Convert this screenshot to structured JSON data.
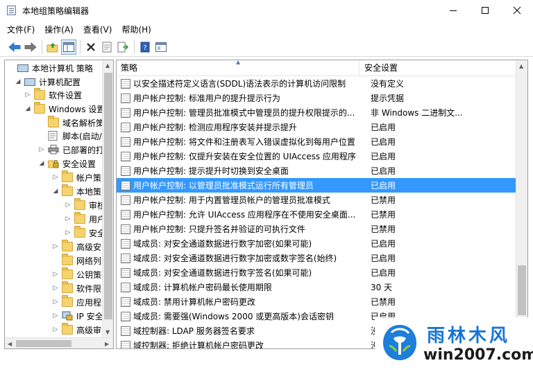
{
  "window": {
    "title": "本地组策略编辑器"
  },
  "menu": [
    "文件(F)",
    "操作(A)",
    "查看(V)",
    "帮助(H)"
  ],
  "tree": [
    {
      "label": "本地计算机 策略",
      "toggle": "",
      "icon": "computer-icon"
    },
    {
      "label": "计算机配置",
      "toggle": "◢",
      "icon": "computer-icon"
    },
    {
      "label": "软件设置",
      "toggle": "▷",
      "icon": "folder-icon"
    },
    {
      "label": "Windows 设置",
      "toggle": "◢",
      "icon": "folder-icon"
    },
    {
      "label": "域名解析策",
      "toggle": "",
      "icon": "folder-icon"
    },
    {
      "label": "脚本(启动/",
      "toggle": "",
      "icon": "script-icon"
    },
    {
      "label": "已部署的打",
      "toggle": "▷",
      "icon": "printer-icon"
    },
    {
      "label": "安全设置",
      "toggle": "◢",
      "icon": "security-folder-icon"
    },
    {
      "label": "帐户策",
      "toggle": "▷",
      "icon": "folder-icon"
    },
    {
      "label": "本地策",
      "toggle": "◢",
      "icon": "folder-icon"
    },
    {
      "label": "审核",
      "toggle": "▷",
      "icon": "folder-icon"
    },
    {
      "label": "用户",
      "toggle": "▷",
      "icon": "folder-icon"
    },
    {
      "label": "安全",
      "toggle": "▷",
      "icon": "folder-icon"
    },
    {
      "label": "高级安",
      "toggle": "▷",
      "icon": "folder-icon"
    },
    {
      "label": "网络列",
      "toggle": "",
      "icon": "folder-icon"
    },
    {
      "label": "公钥策",
      "toggle": "▷",
      "icon": "folder-icon"
    },
    {
      "label": "软件限",
      "toggle": "▷",
      "icon": "folder-icon"
    },
    {
      "label": "应用程",
      "toggle": "▷",
      "icon": "folder-icon"
    },
    {
      "label": "IP 安全",
      "toggle": "▷",
      "icon": "ip-security-icon"
    },
    {
      "label": "高级审",
      "toggle": "▷",
      "icon": "folder-icon"
    }
  ],
  "list": {
    "headers": {
      "policy": "策略",
      "setting": "安全设置"
    },
    "rows": [
      {
        "policy": "以安全描述符定义语言(SDDL)语法表示的计算机访问限制",
        "setting": "没有定义"
      },
      {
        "policy": "用户帐户控制: 标准用户的提升提示行为",
        "setting": "提示凭据"
      },
      {
        "policy": "用户帐户控制: 管理员批准模式中管理员的提升权限提示的...",
        "setting": "非 Windows 二进制文..."
      },
      {
        "policy": "用户帐户控制: 检测应用程序安装并提示提升",
        "setting": "已启用"
      },
      {
        "policy": "用户帐户控制: 将文件和注册表写入错误虚拟化到每用户位置",
        "setting": "已启用"
      },
      {
        "policy": "用户帐户控制: 仅提升安装在安全位置的 UIAccess 应用程序",
        "setting": "已启用"
      },
      {
        "policy": "用户帐户控制: 提示提升时切换到安全桌面",
        "setting": "已启用"
      },
      {
        "policy": "用户帐户控制: 以管理员批准模式运行所有管理员",
        "setting": "已启用",
        "selected": true
      },
      {
        "policy": "用户帐户控制: 用于内置管理员帐户的管理员批准模式",
        "setting": "已禁用"
      },
      {
        "policy": "用户帐户控制: 允许 UIAccess 应用程序在不使用安全桌面...",
        "setting": "已禁用"
      },
      {
        "policy": "用户帐户控制: 只提升签名并验证的可执行文件",
        "setting": "已禁用"
      },
      {
        "policy": "域成员: 对安全通道数据进行数字加密(如果可能)",
        "setting": "已启用"
      },
      {
        "policy": "域成员: 对安全通道数据进行数字加密或数字签名(始终)",
        "setting": "已启用"
      },
      {
        "policy": "域成员: 对安全通道数据进行数字签名(如果可能)",
        "setting": "已启用"
      },
      {
        "policy": "域成员: 计算机帐户密码最长使用期限",
        "setting": "30 天"
      },
      {
        "policy": "域成员: 禁用计算机帐户密码更改",
        "setting": "已禁用"
      },
      {
        "policy": "域成员: 需要强(Windows 2000 或更高版本)会话密钥",
        "setting": "已启用"
      },
      {
        "policy": "域控制器: LDAP 服务器签名要求",
        "setting": "没有"
      },
      {
        "policy": "域控制器: 拒绝计算机帐户密码更改",
        "setting": "没有"
      }
    ]
  },
  "watermark": {
    "brand": "雨林木风",
    "url": "win2007.com"
  },
  "colors": {
    "selection": "#3399ff",
    "brand_blue": "#1775d5"
  }
}
